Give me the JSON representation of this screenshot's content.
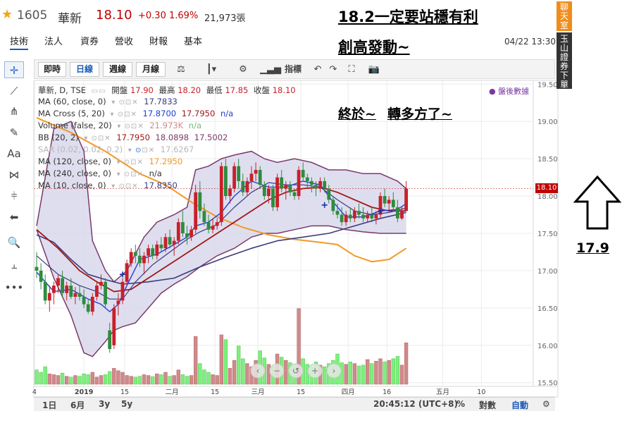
{
  "header": {
    "star_icon": "star-icon",
    "code": "1605",
    "name": "華新",
    "price": "18.10",
    "change": "+0.30",
    "change_pct": "1.69%",
    "volume": "21,973張"
  },
  "tabs": [
    {
      "label": "技術",
      "active": true
    },
    {
      "label": "法人"
    },
    {
      "label": "資券"
    },
    {
      "label": "營收"
    },
    {
      "label": "財報"
    },
    {
      "label": "基本"
    }
  ],
  "datetime": "04/22 13:30",
  "annotations": {
    "title": "18.2一定要站穩有利",
    "line2": "創高發動~",
    "line3a": "終於~",
    "line3b": "轉多方了~",
    "price_note": "17.9"
  },
  "side": {
    "chat": "聊天室",
    "trade": "玉山證券下單"
  },
  "toolbar": {
    "buttons": [
      "即時",
      "日線",
      "週線",
      "月線"
    ],
    "selected": "日線",
    "indicators_label": "指標"
  },
  "legend": {
    "main": {
      "label": "華新, D, TSE",
      "open_label": "開盤",
      "open": "17.90",
      "high_label": "最高",
      "high": "18.20",
      "low_label": "最低",
      "low": "17.85",
      "close_label": "收盤",
      "close": "18.10"
    },
    "ma60": {
      "label": "MA (60, close, 0)",
      "value": "17.7833"
    },
    "macross": {
      "label": "MA Cross (5, 20)",
      "v1": "17.8700",
      "v2": "17.7950",
      "v3": "n/a"
    },
    "volume": {
      "label": "Volume (false, 20)",
      "v1": "21.973K",
      "v2": "n/a"
    },
    "bb": {
      "label": "BB (20, 2)",
      "v1": "17.7950",
      "v2": "18.0898",
      "v3": "17.5002"
    },
    "sar": {
      "label": "SAR (0.02, 0.02, 0.2)",
      "value": "17.6267"
    },
    "ma120": {
      "label": "MA (120, close, 0)",
      "value": "17.2950"
    },
    "ma240": {
      "label": "MA (240, close, 0)",
      "value": "n/a"
    },
    "ma10": {
      "label": "MA (10, close, 0)",
      "value": "17.8350"
    }
  },
  "after_hours": "● 盤後數據",
  "last_price_tag": "18.10",
  "bottom_bar": {
    "ranges": [
      "1日",
      "6月",
      "3y",
      "5y"
    ],
    "clock": "20:45:12 (UTC+8)",
    "pct": "%",
    "log": "對數",
    "auto": "自動",
    "settings_icon": "gear-icon"
  },
  "colors": {
    "up": "#c8202a",
    "down": "#2e8b3e",
    "bb_fill": "#d8d8ec",
    "bb_band": "#7b3a6a",
    "ma5": "#1f3fd6",
    "ma20": "#a01818",
    "ma60": "#3b3b80",
    "ma120": "#f29a26",
    "vol_up": "#d08a8a",
    "vol_down": "#7cf07c"
  },
  "chart_data": {
    "type": "candlestick",
    "ylim": [
      15.45,
      19.55
    ],
    "yticks": [
      15.5,
      16.0,
      16.5,
      17.0,
      17.5,
      18.0,
      18.5,
      19.0,
      19.5
    ],
    "ytick_labels": [
      "15.50",
      "16.00",
      "16.50",
      "17.00",
      "17.50",
      "18.00",
      "18.50",
      "19.00",
      "19.50"
    ],
    "xticks": [
      {
        "label": "4",
        "i": -0.5
      },
      {
        "label": "2019",
        "i": 11
      },
      {
        "label": "15",
        "i": 20.5
      },
      {
        "label": "二月",
        "i": 31.5
      },
      {
        "label": "15",
        "i": 41.5
      },
      {
        "label": "三月",
        "i": 51.5
      },
      {
        "label": "15",
        "i": 61.5
      },
      {
        "label": "四月",
        "i": 72.5
      },
      {
        "label": "16",
        "i": 81.5
      },
      {
        "label": "五月",
        "i": 94.5
      },
      {
        "label": "10",
        "i": 103.5
      }
    ],
    "ohlc": [
      [
        17.05,
        17.25,
        16.9,
        17.0
      ],
      [
        17.0,
        17.1,
        16.75,
        16.85
      ],
      [
        16.85,
        16.95,
        16.55,
        16.6
      ],
      [
        16.6,
        16.8,
        16.45,
        16.7
      ],
      [
        16.7,
        16.85,
        16.55,
        16.8
      ],
      [
        16.8,
        16.95,
        16.7,
        16.9
      ],
      [
        16.9,
        17.0,
        16.65,
        16.7
      ],
      [
        16.7,
        16.85,
        16.6,
        16.8
      ],
      [
        16.8,
        16.9,
        16.62,
        16.65
      ],
      [
        16.65,
        16.78,
        16.55,
        16.7
      ],
      [
        16.7,
        16.8,
        16.6,
        16.65
      ],
      [
        16.65,
        16.75,
        16.5,
        16.55
      ],
      [
        16.55,
        16.62,
        16.42,
        16.45
      ],
      [
        16.45,
        16.7,
        16.4,
        16.65
      ],
      [
        16.65,
        16.85,
        16.6,
        16.8
      ],
      [
        16.8,
        16.95,
        16.75,
        16.85
      ],
      [
        16.85,
        16.9,
        16.5,
        16.55
      ],
      [
        16.2,
        16.3,
        15.9,
        15.95
      ],
      [
        16.0,
        16.55,
        15.95,
        16.5
      ],
      [
        16.55,
        16.7,
        16.4,
        16.6
      ],
      [
        16.6,
        16.9,
        16.55,
        16.85
      ],
      [
        16.85,
        17.15,
        16.8,
        17.1
      ],
      [
        17.1,
        17.3,
        17.05,
        17.25
      ],
      [
        17.25,
        17.35,
        17.1,
        17.2
      ],
      [
        17.2,
        17.3,
        17.05,
        17.1
      ],
      [
        17.1,
        17.25,
        16.95,
        17.2
      ],
      [
        17.2,
        17.35,
        17.1,
        17.3
      ],
      [
        17.3,
        17.35,
        17.15,
        17.2
      ],
      [
        17.2,
        17.4,
        17.15,
        17.35
      ],
      [
        17.35,
        17.45,
        17.25,
        17.3
      ],
      [
        17.3,
        17.5,
        17.25,
        17.45
      ],
      [
        17.45,
        17.55,
        17.3,
        17.35
      ],
      [
        17.35,
        17.45,
        17.2,
        17.4
      ],
      [
        17.4,
        17.7,
        17.35,
        17.65
      ],
      [
        17.65,
        17.8,
        17.45,
        17.5
      ],
      [
        17.5,
        17.6,
        17.35,
        17.45
      ],
      [
        17.45,
        17.6,
        17.4,
        17.55
      ],
      [
        17.55,
        18.15,
        17.5,
        18.05
      ],
      [
        18.05,
        18.2,
        17.7,
        17.8
      ],
      [
        17.8,
        17.9,
        17.6,
        17.65
      ],
      [
        17.65,
        17.75,
        17.5,
        17.55
      ],
      [
        17.55,
        17.7,
        17.5,
        17.6
      ],
      [
        17.6,
        17.7,
        17.55,
        17.65
      ],
      [
        17.65,
        18.45,
        17.6,
        18.4
      ],
      [
        18.4,
        18.5,
        17.95,
        18.0
      ],
      [
        18.0,
        18.15,
        17.9,
        18.1
      ],
      [
        18.1,
        18.45,
        18.05,
        18.4
      ],
      [
        18.4,
        18.5,
        18.1,
        18.2
      ],
      [
        18.2,
        18.3,
        18.0,
        18.05
      ],
      [
        18.05,
        18.25,
        18.0,
        18.2
      ],
      [
        18.2,
        18.4,
        18.1,
        18.3
      ],
      [
        18.3,
        18.45,
        18.2,
        18.35
      ],
      [
        18.35,
        18.4,
        18.1,
        18.15
      ],
      [
        18.15,
        18.2,
        17.95,
        18.0
      ],
      [
        18.0,
        18.15,
        17.9,
        18.1
      ],
      [
        18.1,
        18.15,
        17.8,
        17.85
      ],
      [
        17.85,
        18.3,
        17.8,
        18.25
      ],
      [
        18.25,
        18.35,
        18.05,
        18.1
      ],
      [
        18.1,
        18.2,
        17.95,
        18.15
      ],
      [
        18.15,
        18.2,
        18.0,
        18.05
      ],
      [
        18.05,
        18.1,
        17.95,
        18.0
      ],
      [
        18.0,
        18.4,
        17.95,
        18.35
      ],
      [
        18.35,
        18.45,
        18.2,
        18.25
      ],
      [
        18.25,
        18.3,
        18.1,
        18.2
      ],
      [
        18.2,
        18.25,
        18.05,
        18.15
      ],
      [
        18.15,
        18.2,
        18.0,
        18.1
      ],
      [
        18.1,
        18.25,
        18.05,
        18.2
      ],
      [
        18.2,
        18.25,
        18.05,
        18.1
      ],
      [
        18.1,
        18.15,
        17.9,
        17.95
      ],
      [
        17.95,
        18.0,
        17.75,
        17.8
      ],
      [
        17.8,
        17.9,
        17.7,
        17.75
      ],
      [
        17.75,
        17.85,
        17.6,
        17.65
      ],
      [
        17.65,
        17.8,
        17.6,
        17.75
      ],
      [
        17.75,
        17.85,
        17.65,
        17.7
      ],
      [
        17.7,
        17.85,
        17.65,
        17.8
      ],
      [
        17.8,
        17.9,
        17.7,
        17.75
      ],
      [
        17.75,
        17.85,
        17.65,
        17.7
      ],
      [
        17.7,
        17.8,
        17.65,
        17.75
      ],
      [
        17.75,
        17.85,
        17.65,
        17.7
      ],
      [
        17.7,
        17.8,
        17.62,
        17.75
      ],
      [
        17.75,
        18.05,
        17.7,
        18.0
      ],
      [
        18.0,
        18.1,
        17.85,
        17.9
      ],
      [
        17.9,
        18.0,
        17.8,
        17.95
      ],
      [
        17.95,
        18.05,
        17.8,
        17.85
      ],
      [
        17.85,
        17.95,
        17.65,
        17.7
      ],
      [
        17.7,
        17.85,
        17.68,
        17.8
      ],
      [
        17.8,
        18.2,
        17.85,
        18.1
      ]
    ],
    "volume": [
      180,
      150,
      220,
      130,
      120,
      110,
      140,
      100,
      90,
      110,
      100,
      130,
      120,
      150,
      90,
      110,
      120,
      160,
      200,
      170,
      150,
      110,
      100,
      90,
      100,
      120,
      110,
      95,
      130,
      120,
      150,
      100,
      110,
      180,
      120,
      100,
      110,
      600,
      260,
      180,
      150,
      120,
      110,
      620,
      560,
      200,
      300,
      480,
      320,
      260,
      220,
      300,
      420,
      330,
      250,
      230,
      380,
      340,
      300,
      270,
      250,
      950,
      320,
      250,
      230,
      280,
      240,
      220,
      260,
      300,
      380,
      270,
      250,
      280,
      260,
      230,
      240,
      310,
      260,
      290,
      320,
      280,
      300,
      320,
      350,
      240,
      520
    ],
    "vol_max": 1000,
    "ma5": [
      [
        0,
        16.98
      ],
      [
        4,
        16.72
      ],
      [
        8,
        16.75
      ],
      [
        12,
        16.62
      ],
      [
        15,
        16.55
      ],
      [
        17,
        16.45
      ],
      [
        19,
        16.55
      ],
      [
        21,
        16.8
      ],
      [
        24,
        17.15
      ],
      [
        28,
        17.22
      ],
      [
        32,
        17.35
      ],
      [
        35,
        17.45
      ],
      [
        37,
        17.6
      ],
      [
        40,
        17.65
      ],
      [
        43,
        17.78
      ],
      [
        46,
        18.0
      ],
      [
        50,
        18.2
      ],
      [
        54,
        18.12
      ],
      [
        58,
        18.12
      ],
      [
        62,
        18.2
      ],
      [
        66,
        18.15
      ],
      [
        69,
        17.92
      ],
      [
        72,
        17.72
      ],
      [
        76,
        17.72
      ],
      [
        80,
        17.8
      ],
      [
        84,
        17.82
      ],
      [
        86,
        17.9
      ]
    ],
    "ma10": [
      [
        0,
        17.2
      ],
      [
        5,
        16.95
      ],
      [
        10,
        16.8
      ],
      [
        14,
        16.72
      ],
      [
        17,
        16.62
      ],
      [
        20,
        16.62
      ],
      [
        23,
        16.85
      ],
      [
        27,
        17.08
      ],
      [
        31,
        17.25
      ],
      [
        35,
        17.42
      ],
      [
        38,
        17.52
      ],
      [
        42,
        17.62
      ],
      [
        46,
        17.85
      ],
      [
        50,
        18.05
      ],
      [
        54,
        18.18
      ],
      [
        58,
        18.15
      ],
      [
        62,
        18.15
      ],
      [
        66,
        18.12
      ],
      [
        70,
        17.95
      ],
      [
        74,
        17.8
      ],
      [
        78,
        17.75
      ],
      [
        82,
        17.78
      ],
      [
        86,
        17.84
      ]
    ],
    "ma20": [
      [
        0,
        17.55
      ],
      [
        5,
        17.3
      ],
      [
        10,
        17.0
      ],
      [
        14,
        16.85
      ],
      [
        18,
        16.72
      ],
      [
        22,
        16.75
      ],
      [
        26,
        16.9
      ],
      [
        30,
        17.05
      ],
      [
        34,
        17.2
      ],
      [
        38,
        17.35
      ],
      [
        42,
        17.5
      ],
      [
        46,
        17.65
      ],
      [
        50,
        17.8
      ],
      [
        54,
        17.95
      ],
      [
        58,
        18.05
      ],
      [
        62,
        18.1
      ],
      [
        66,
        18.12
      ],
      [
        70,
        18.05
      ],
      [
        74,
        17.95
      ],
      [
        78,
        17.85
      ],
      [
        82,
        17.8
      ],
      [
        86,
        17.8
      ]
    ],
    "ma60": [
      [
        0,
        17.48
      ],
      [
        4,
        17.38
      ],
      [
        8,
        17.15
      ],
      [
        12,
        16.95
      ],
      [
        16,
        16.88
      ],
      [
        20,
        16.82
      ],
      [
        26,
        16.85
      ],
      [
        32,
        16.9
      ],
      [
        38,
        17.05
      ],
      [
        44,
        17.18
      ],
      [
        50,
        17.3
      ],
      [
        56,
        17.4
      ],
      [
        62,
        17.45
      ],
      [
        68,
        17.5
      ],
      [
        74,
        17.6
      ],
      [
        80,
        17.7
      ],
      [
        86,
        17.78
      ]
    ],
    "ma120": [
      [
        0,
        19.05
      ],
      [
        8,
        18.85
      ],
      [
        16,
        18.6
      ],
      [
        24,
        18.3
      ],
      [
        30,
        18.15
      ],
      [
        36,
        17.92
      ],
      [
        42,
        17.72
      ],
      [
        48,
        17.58
      ],
      [
        54,
        17.48
      ],
      [
        60,
        17.42
      ],
      [
        66,
        17.38
      ],
      [
        70,
        17.35
      ],
      [
        74,
        17.2
      ],
      [
        78,
        17.12
      ],
      [
        82,
        17.15
      ],
      [
        86,
        17.3
      ]
    ],
    "bb_upper": [
      [
        0,
        17.6
      ],
      [
        4,
        18.9
      ],
      [
        8,
        19.0
      ],
      [
        11,
        18.6
      ],
      [
        13,
        17.4
      ],
      [
        16,
        17.0
      ],
      [
        18,
        16.85
      ],
      [
        21,
        17.0
      ],
      [
        25,
        17.45
      ],
      [
        28,
        17.65
      ],
      [
        32,
        17.75
      ],
      [
        35,
        17.85
      ],
      [
        37,
        18.35
      ],
      [
        40,
        18.4
      ],
      [
        43,
        18.5
      ],
      [
        46,
        18.55
      ],
      [
        50,
        18.6
      ],
      [
        53,
        18.5
      ],
      [
        56,
        18.45
      ],
      [
        60,
        18.5
      ],
      [
        64,
        18.45
      ],
      [
        68,
        18.35
      ],
      [
        72,
        18.35
      ],
      [
        76,
        18.3
      ],
      [
        80,
        18.3
      ],
      [
        84,
        18.2
      ],
      [
        86,
        18.1
      ]
    ],
    "bb_lower": [
      [
        0,
        17.55
      ],
      [
        4,
        16.9
      ],
      [
        8,
        16.4
      ],
      [
        11,
        15.9
      ],
      [
        13,
        15.85
      ],
      [
        16,
        16.05
      ],
      [
        18,
        16.2
      ],
      [
        20,
        16.25
      ],
      [
        23,
        16.3
      ],
      [
        26,
        16.5
      ],
      [
        29,
        16.7
      ],
      [
        32,
        16.82
      ],
      [
        35,
        16.92
      ],
      [
        38,
        17.05
      ],
      [
        42,
        17.2
      ],
      [
        46,
        17.3
      ],
      [
        50,
        17.45
      ],
      [
        53,
        17.5
      ],
      [
        56,
        17.5
      ],
      [
        60,
        17.55
      ],
      [
        64,
        17.6
      ],
      [
        68,
        17.6
      ],
      [
        72,
        17.55
      ],
      [
        76,
        17.52
      ],
      [
        80,
        17.5
      ],
      [
        84,
        17.5
      ],
      [
        86,
        17.5
      ]
    ],
    "sar_points": [
      [
        20,
        16.95
      ],
      [
        67,
        17.88
      ],
      [
        80,
        17.8
      ]
    ]
  }
}
